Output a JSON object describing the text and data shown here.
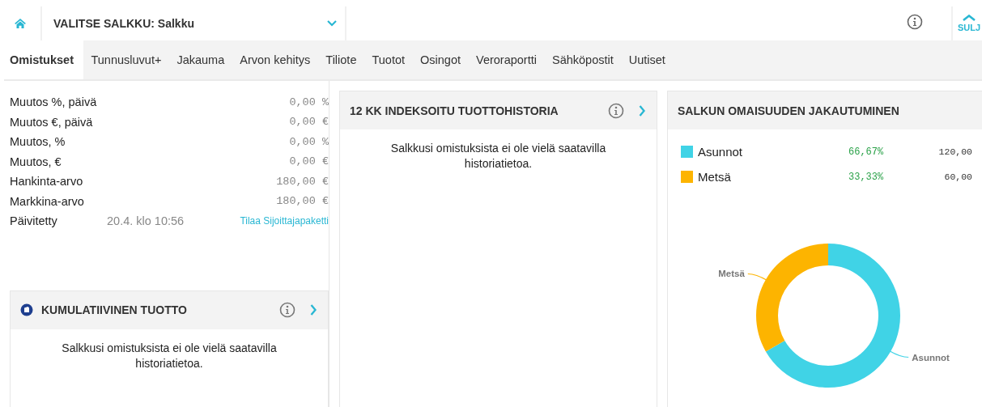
{
  "header": {
    "selector_label": "VALITSE SALKKU:",
    "selector_value": "Salkku",
    "close_label": "SULJ"
  },
  "tabs": [
    {
      "label": "Omistukset",
      "selected": true
    },
    {
      "label": "Tunnusluvut+",
      "selected": false
    },
    {
      "label": "Jakauma",
      "selected": false
    },
    {
      "label": "Arvon kehitys",
      "selected": false
    },
    {
      "label": "Tiliote",
      "selected": false
    },
    {
      "label": "Tuotot",
      "selected": false
    },
    {
      "label": "Osingot",
      "selected": false
    },
    {
      "label": "Veroraportti",
      "selected": false
    },
    {
      "label": "Sähköpostit",
      "selected": false
    },
    {
      "label": "Uutiset",
      "selected": false
    }
  ],
  "stats": [
    {
      "label": "Muutos %, päivä",
      "value": "0,00 %"
    },
    {
      "label": "Muutos €, päivä",
      "value": "0,00 €"
    },
    {
      "label": "Muutos, %",
      "value": "0,00 %"
    },
    {
      "label": "Muutos, €",
      "value": "0,00 €"
    },
    {
      "label": "Hankinta-arvo",
      "value": "180,00 €"
    },
    {
      "label": "Markkina-arvo",
      "value": "180,00 €"
    }
  ],
  "updated": {
    "label": "Päivitetty",
    "value": "20.4. klo 10:56",
    "link": "Tilaa Sijoittajapaketti"
  },
  "cumulative_card": {
    "title": "KUMULATIIVINEN TUOTTO",
    "message": "Salkkusi omistuksista ei ole vielä saatavilla historiatietoa."
  },
  "history_card": {
    "title": "12 KK INDEKSOITU TUOTTOHISTORIA",
    "message": "Salkkusi omistuksista ei ole vielä saatavilla historiatietoa."
  },
  "allocation_card": {
    "title": "SALKUN OMAISUUDEN JAKAUTUMINEN",
    "legend": [
      {
        "name": "Asunnot",
        "color": "#40d3e6",
        "percent": "66,67%",
        "amount": "120,00"
      },
      {
        "name": "Metsä",
        "color": "#fdb400",
        "percent": "33,33%",
        "amount": "60,00"
      }
    ],
    "chart_data": {
      "type": "donut",
      "categories": [
        "Asunnot",
        "Metsä"
      ],
      "values": [
        66.67,
        33.33
      ]
    }
  }
}
